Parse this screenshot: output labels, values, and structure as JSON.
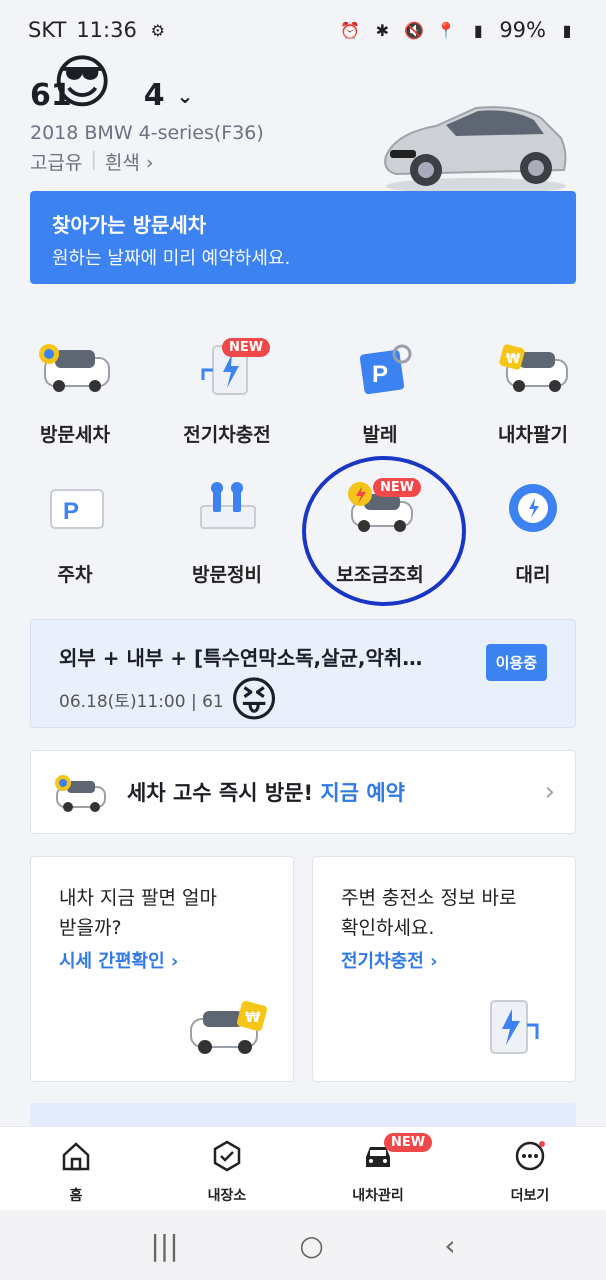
{
  "status": {
    "carrier": "SKT",
    "time": "11:36",
    "battery": "99%"
  },
  "car": {
    "plate_a": "61",
    "plate_b": "4",
    "model": "2018 BMW 4-series(F36)",
    "fuel": "고급유",
    "color": "흰색 ›"
  },
  "banner": {
    "title": "찾아가는 방문세차",
    "subtitle": "원하는 날짜에 미리 예약하세요."
  },
  "services": [
    {
      "label": "방문세차",
      "icon": "car-wash-icon"
    },
    {
      "label": "전기차충전",
      "icon": "ev-charge-icon",
      "badge": "NEW"
    },
    {
      "label": "발레",
      "icon": "valet-parking-icon"
    },
    {
      "label": "내차팔기",
      "icon": "sell-car-icon"
    },
    {
      "label": "주차",
      "icon": "parking-icon"
    },
    {
      "label": "방문정비",
      "icon": "toolbox-icon"
    },
    {
      "label": "보조금조회",
      "icon": "subsidy-icon",
      "badge": "NEW"
    },
    {
      "label": "대리",
      "icon": "steering-wheel-icon"
    }
  ],
  "current": {
    "title": "외부 + 내부 + [특수연막소독,살균,악취제…",
    "date": "06.18(토)11:00 | 61",
    "badge": "이용중"
  },
  "visit": {
    "text": "세차 고수 즉시 방문! ",
    "highlight": "지금 예약",
    "arrow": "›"
  },
  "cards": [
    {
      "line1": "내차 지금 팔면 얼마",
      "line2": "받을까?",
      "link": "시세 간편확인 ›"
    },
    {
      "line1": "주변 충전소 정보 바로",
      "line2": "확인하세요.",
      "link": "전기차충전 ›"
    }
  ],
  "nav": [
    {
      "label": "홈",
      "icon": "home-icon"
    },
    {
      "label": "내장소",
      "icon": "places-icon"
    },
    {
      "label": "내차관리",
      "icon": "car-manage-icon",
      "badge": "NEW"
    },
    {
      "label": "더보기",
      "icon": "more-icon"
    }
  ],
  "sysnav": {
    "recents": "|||",
    "home": "○",
    "back": "‹"
  },
  "colors": {
    "primary": "#3d82f1",
    "badge": "#f04848",
    "circle": "#1a36c4"
  }
}
